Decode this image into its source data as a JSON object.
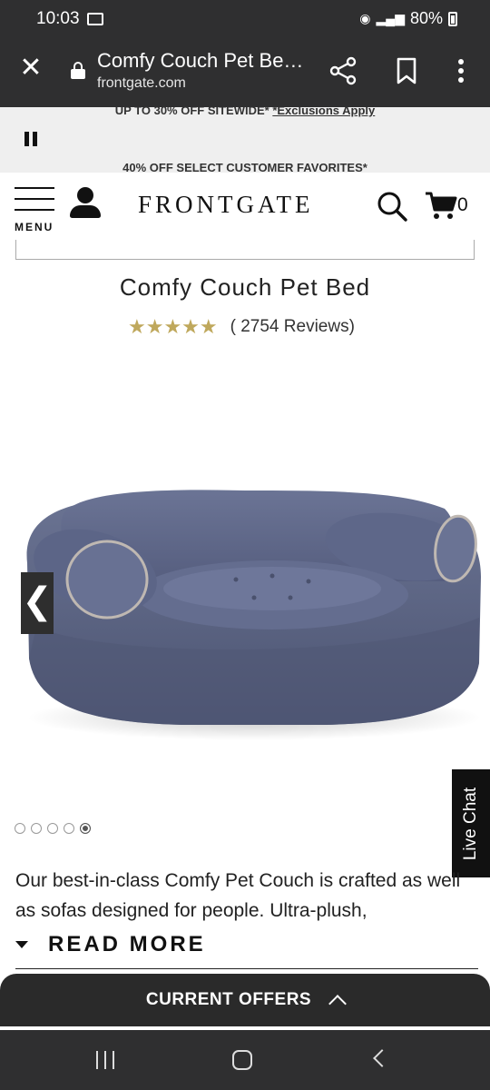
{
  "status_bar": {
    "time": "10:03",
    "battery": "80%"
  },
  "browser": {
    "title": "Comfy Couch Pet Be…",
    "url": "frontgate.com"
  },
  "promo": {
    "line1_text": "UP TO 30% OFF SITEWIDE* ",
    "line1_link": "*Exclusions Apply",
    "line2_text": "40% OFF SELECT CUSTOMER FAVORITES*"
  },
  "header": {
    "menu_label": "MENU",
    "logo": "FRONTGATE",
    "cart_count": "0"
  },
  "product": {
    "title": "Comfy Couch Pet Bed",
    "stars": "★★★★★",
    "rating": 4.8,
    "reviews": "( 2754 Reviews)",
    "image_count": 5,
    "active_image_index": 5,
    "description": "Our best-in-class Comfy Pet Couch is crafted as well as sofas designed for people. Ultra-plush,",
    "read_more": "READ MORE"
  },
  "live_chat": "Live Chat",
  "offers": {
    "label": "CURRENT OFFERS"
  },
  "icons": {
    "close": "close-icon",
    "lock": "lock-icon",
    "share": "share-icon",
    "bookmark": "bookmark-icon",
    "more": "more-vert-icon",
    "pause": "pause-icon",
    "menu": "hamburger-icon",
    "account": "user-icon",
    "search": "search-icon",
    "cart": "cart-icon",
    "prev": "chevron-left-icon",
    "expand": "chevron-up-icon"
  },
  "colors": {
    "star": "#bfa85c",
    "chrome": "#2f2f30",
    "bed": "#5b6484"
  }
}
